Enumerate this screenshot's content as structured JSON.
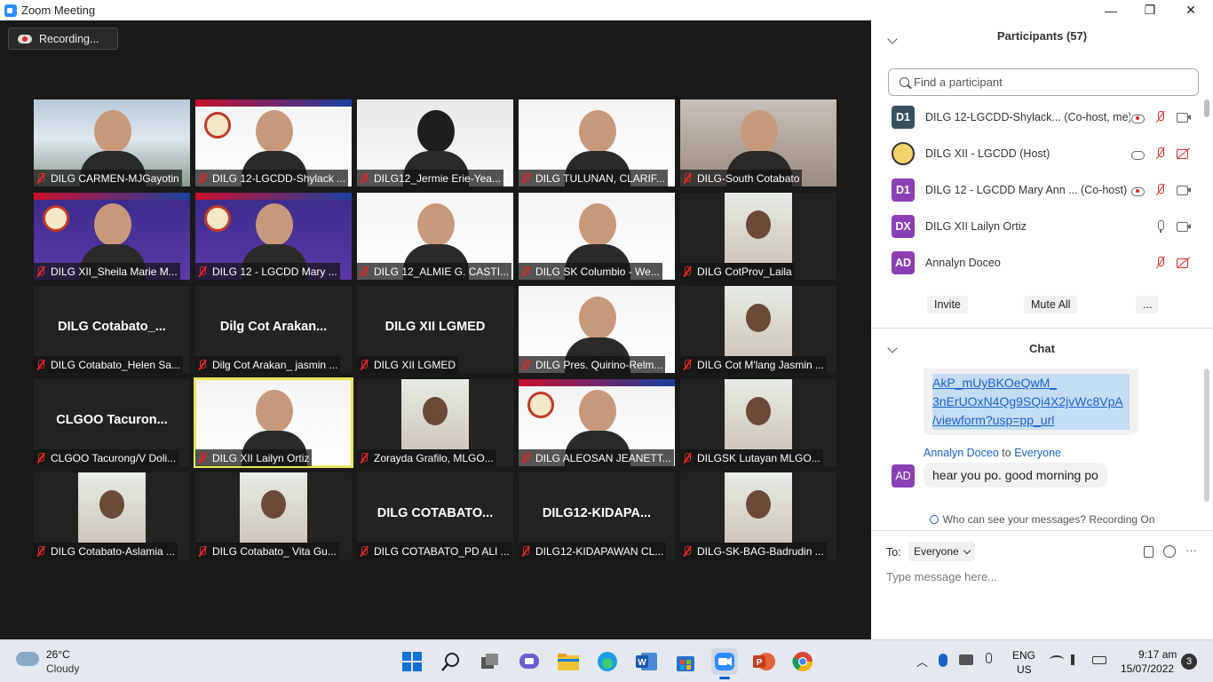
{
  "window": {
    "title": "Zoom Meeting",
    "minimize": "—",
    "maximize": "❐",
    "close": "✕"
  },
  "recording": {
    "label": "Recording..."
  },
  "tiles": [
    {
      "name": "DILG CARMEN-MJGayotin",
      "big": "",
      "kind": "building"
    },
    {
      "name": "DILG 12-LGCDD-Shylack ...",
      "big": "",
      "kind": "person"
    },
    {
      "name": "DILG12_Jermie Erie-Yea...",
      "big": "",
      "kind": "person-dark"
    },
    {
      "name": "DILG TULUNAN, CLARIF...",
      "big": "",
      "kind": "person-white"
    },
    {
      "name": "DILG-South Cotabato",
      "big": "",
      "kind": "room"
    },
    {
      "name": "DILG XII_Sheila Marie M...",
      "big": "",
      "kind": "person-purple"
    },
    {
      "name": "DILG 12 - LGCDD Mary ...",
      "big": "",
      "kind": "person-purple"
    },
    {
      "name": "DILG 12_ALMIE G. CASTI...",
      "big": "",
      "kind": "person-white"
    },
    {
      "name": "DILG SK Columbio - We...",
      "big": "",
      "kind": "person-white"
    },
    {
      "name": "DILG CotProv_Laila",
      "big": "",
      "kind": "small-photo"
    },
    {
      "name": "DILG Cotabato_Helen Sa...",
      "big": "DILG  Cotabato_...",
      "kind": "text"
    },
    {
      "name": "Dilg Cot Arakan_ jasmin ...",
      "big": "Dilg  Cot  Arakan...",
      "kind": "text"
    },
    {
      "name": "DILG XII LGMED",
      "big": "DILG XII LGMED",
      "kind": "text"
    },
    {
      "name": "DILG Pres. Quirino-Relm...",
      "big": "",
      "kind": "person-white"
    },
    {
      "name": "DILG Cot M'lang Jasmin ...",
      "big": "",
      "kind": "small-photo"
    },
    {
      "name": "CLGOO Tacurong/V Doli...",
      "big": "CLGOO  Tacuron...",
      "kind": "text"
    },
    {
      "name": "DILG XII Lailyn Ortiz",
      "big": "",
      "kind": "person-white",
      "active": true
    },
    {
      "name": "Zorayda Grafilo, MLGO...",
      "big": "",
      "kind": "small-photo"
    },
    {
      "name": "DILG ALEOSAN JEANETT...",
      "big": "",
      "kind": "person"
    },
    {
      "name": "DILGSK Lutayan  MLGO...",
      "big": "",
      "kind": "small-photo"
    },
    {
      "name": "DILG Cotabato-Aslamia ...",
      "big": "",
      "kind": "small-photo"
    },
    {
      "name": "DILG Cotabato_ Vita Gu...",
      "big": "",
      "kind": "small-photo"
    },
    {
      "name": "DILG COTABATO_PD ALI ...",
      "big": "DILG  COTABATO...",
      "kind": "text"
    },
    {
      "name": "DILG12-KIDAPAWAN CL...",
      "big": "DILG12-KIDAPA...",
      "kind": "text"
    },
    {
      "name": "DILG-SK-BAG-Badrudin ...",
      "big": "",
      "kind": "small-photo"
    }
  ],
  "participants": {
    "title": "Participants (57)",
    "search_placeholder": "Find a participant",
    "list": [
      {
        "initials": "D1",
        "name": "DILG 12-LGCDD-Shylack... (Co-host, me)",
        "color": "#3a4f5e"
      },
      {
        "initials": "",
        "name": "DILG XII - LGCDD (Host)",
        "color": "#ffffff"
      },
      {
        "initials": "D1",
        "name": "DILG 12 - LGCDD Mary Ann ... (Co-host)",
        "color": "#8a3fb5"
      },
      {
        "initials": "DX",
        "name": "DILG XII Lailyn Ortiz",
        "color": "#8a3fb5"
      },
      {
        "initials": "AD",
        "name": "Annalyn Doceo",
        "color": "#8a3fb5"
      }
    ],
    "invite": "Invite",
    "mute_all": "Mute All",
    "more": "..."
  },
  "chat": {
    "title": "Chat",
    "link_lines": [
      "AkP_mUyBKOeQwM_",
      "3nErUOxN4Qg9SQi4X2jvWc8VpA",
      "/viewform?usp=pp_url"
    ],
    "sender": "Annalyn Doceo",
    "to_word": "to",
    "recipient": "Everyone",
    "avatar": "AD",
    "message": "hear you po. good morning po",
    "visibility": "Who can see your messages? Recording On",
    "to_label": "To:",
    "to_value": "Everyone",
    "input_placeholder": "Type message here..."
  },
  "taskbar": {
    "weather_temp": "26°C",
    "weather_desc": "Cloudy",
    "lang1": "ENG",
    "lang2": "US",
    "time": "9:17 am",
    "date": "15/07/2022",
    "notif_count": "3"
  }
}
